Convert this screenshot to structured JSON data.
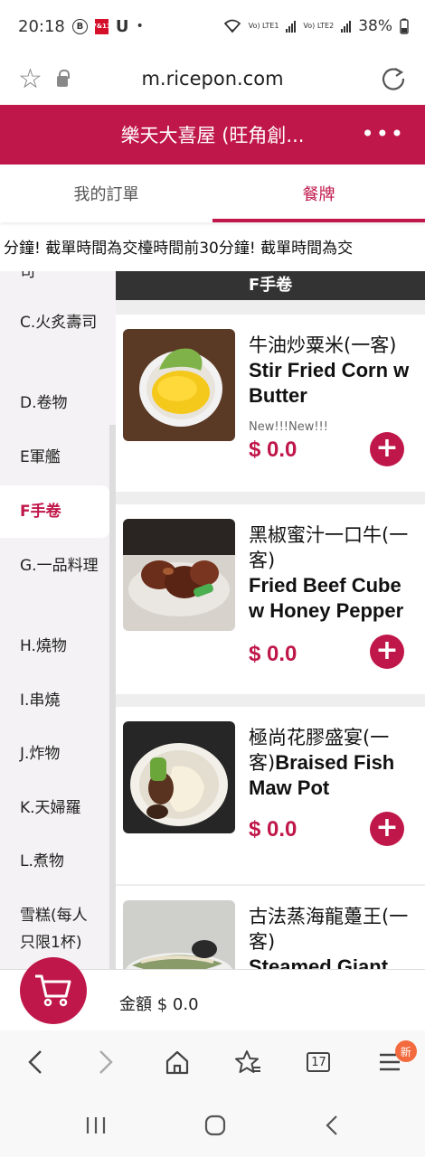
{
  "status_bar": {
    "time": "20:18",
    "icon_b": "B",
    "icon_711": "7&11",
    "icon_u": "U",
    "dot": "•",
    "lte1": "Vo) LTE1",
    "lte2": "Vo) LTE2",
    "battery": "38%"
  },
  "browser": {
    "url": "m.ricepon.com"
  },
  "header": {
    "title": "樂天大喜屋 (旺角創...",
    "more": "•••"
  },
  "tabs": {
    "orders": "我的訂單",
    "menu": "餐牌"
  },
  "marquee": {
    "text": "分鐘! 截單時間為交檯時間前30分鐘! 截單時間為交"
  },
  "sidebar": {
    "categories": [
      {
        "label": "司"
      },
      {
        "label": "C.火炙壽司"
      },
      {
        "label": "D.卷物"
      },
      {
        "label": "E軍艦"
      },
      {
        "label": "F手卷"
      },
      {
        "label": "G.一品料理"
      },
      {
        "label": "H.燒物"
      },
      {
        "label": "I.串燒"
      },
      {
        "label": "J.炸物"
      },
      {
        "label": "K.天婦羅"
      },
      {
        "label": "L.煮物"
      },
      {
        "label": "雪糕(每人只限1杯)"
      }
    ]
  },
  "section": {
    "title": "F手卷"
  },
  "products": [
    {
      "name_zh": "牛油炒粟米(一客)",
      "name_en": "Stir Fried Corn w Butter",
      "tag": "New!!!New!!!",
      "price": "$ 0.0"
    },
    {
      "name_zh": "黑椒蜜汁一口牛(一客)",
      "name_en": "Fried Beef Cube w Honey Pepper",
      "price": "$ 0.0"
    },
    {
      "name_zh": "極尚花膠盛宴(一客)",
      "name_en": "Braised Fish Maw Pot",
      "price": "$ 0.0"
    },
    {
      "name_zh": "古法蒸海龍躉王(一客)",
      "name_en": "Steamed Giant",
      "price": ""
    }
  ],
  "cart": {
    "total": "金額 $ 0.0"
  },
  "bottom_nav": {
    "tab_count": "17",
    "new_badge": "新"
  },
  "colors": {
    "brand": "#c0174a",
    "badge": "#f26a3d"
  }
}
